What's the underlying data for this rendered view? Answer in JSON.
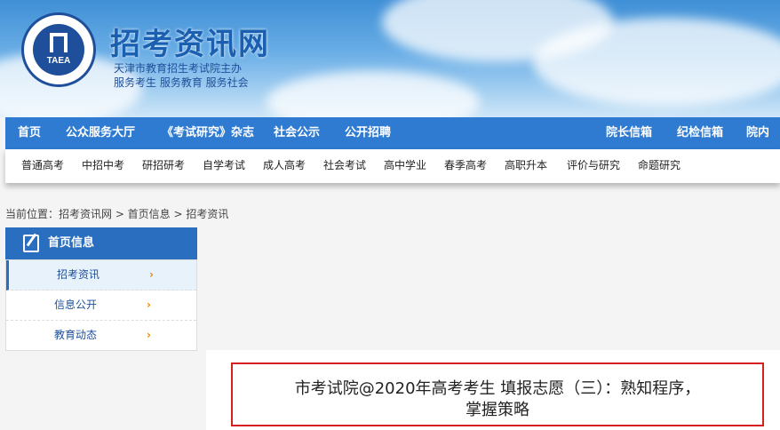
{
  "header": {
    "site_title": "招考资讯网",
    "subtitle_line1": "天津市教育招生考试院主办",
    "subtitle_line2": "服务考生 服务教育 服务社会",
    "logo_text": "TAEA"
  },
  "main_nav": {
    "items": [
      {
        "label": "首页"
      },
      {
        "label": "公众服务大厅"
      },
      {
        "label": "《考试研究》杂志"
      },
      {
        "label": "社会公示"
      },
      {
        "label": "公开招聘"
      },
      {
        "label": "院长信箱"
      },
      {
        "label": "纪检信箱"
      },
      {
        "label": "院内邮"
      }
    ]
  },
  "sub_nav": {
    "items": [
      {
        "label": "普通高考"
      },
      {
        "label": "中招中考"
      },
      {
        "label": "研招研考"
      },
      {
        "label": "自学考试"
      },
      {
        "label": "成人高考"
      },
      {
        "label": "社会考试"
      },
      {
        "label": "高中学业"
      },
      {
        "label": "春季高考"
      },
      {
        "label": "高职升本"
      },
      {
        "label": "评价与研究"
      },
      {
        "label": "命题研究"
      }
    ]
  },
  "breadcrumb": "当前位置：招考资讯网 > 首页信息 > 招考资讯",
  "sidebar": {
    "title": "首页信息",
    "items": [
      {
        "label": "招考资讯",
        "arrow": "›"
      },
      {
        "label": "信息公开",
        "arrow": "›"
      },
      {
        "label": "教育动态",
        "arrow": "›"
      }
    ]
  },
  "article": {
    "title_line1": "市考试院@2020年高考考生 填报志愿（三）：熟知程序，",
    "title_line2": "掌握策略"
  },
  "colors": {
    "nav_blue": "#2f7bd1",
    "sidebar_blue": "#2a6fbf",
    "highlight_red": "#d62020",
    "arrow_orange": "#e88a00"
  }
}
